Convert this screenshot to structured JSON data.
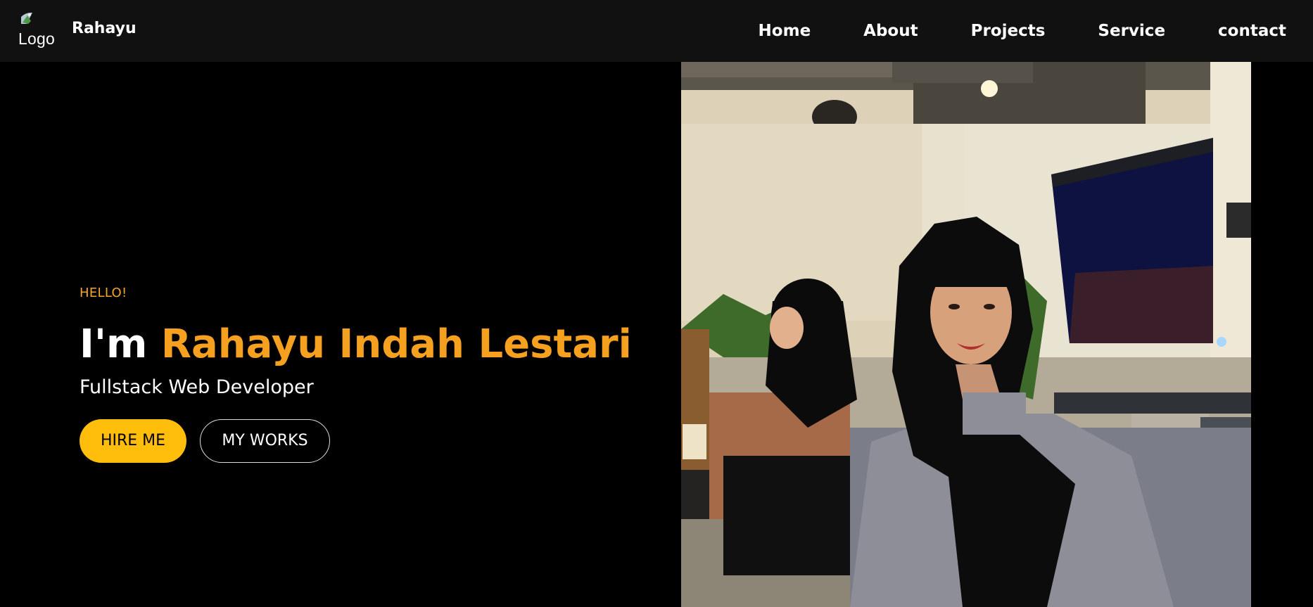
{
  "navbar": {
    "logo_alt": "Logo",
    "brand": "Rahayu",
    "links": [
      "Home",
      "About",
      "Projects",
      "Service",
      "contact"
    ]
  },
  "hero": {
    "greeting": "HELLO!",
    "headline_prefix": "I'm",
    "headline_name": "Rahayu Indah Lestari",
    "role": "Fullstack Web Developer",
    "buttons": {
      "hire": "HIRE ME",
      "works": "MY WORKS"
    }
  },
  "colors": {
    "accent": "#f5a01e",
    "button_yellow": "#ffbe0b",
    "navbar_bg": "#111111",
    "page_bg": "#000000"
  },
  "icons": {
    "logo": "broken-image-icon"
  }
}
